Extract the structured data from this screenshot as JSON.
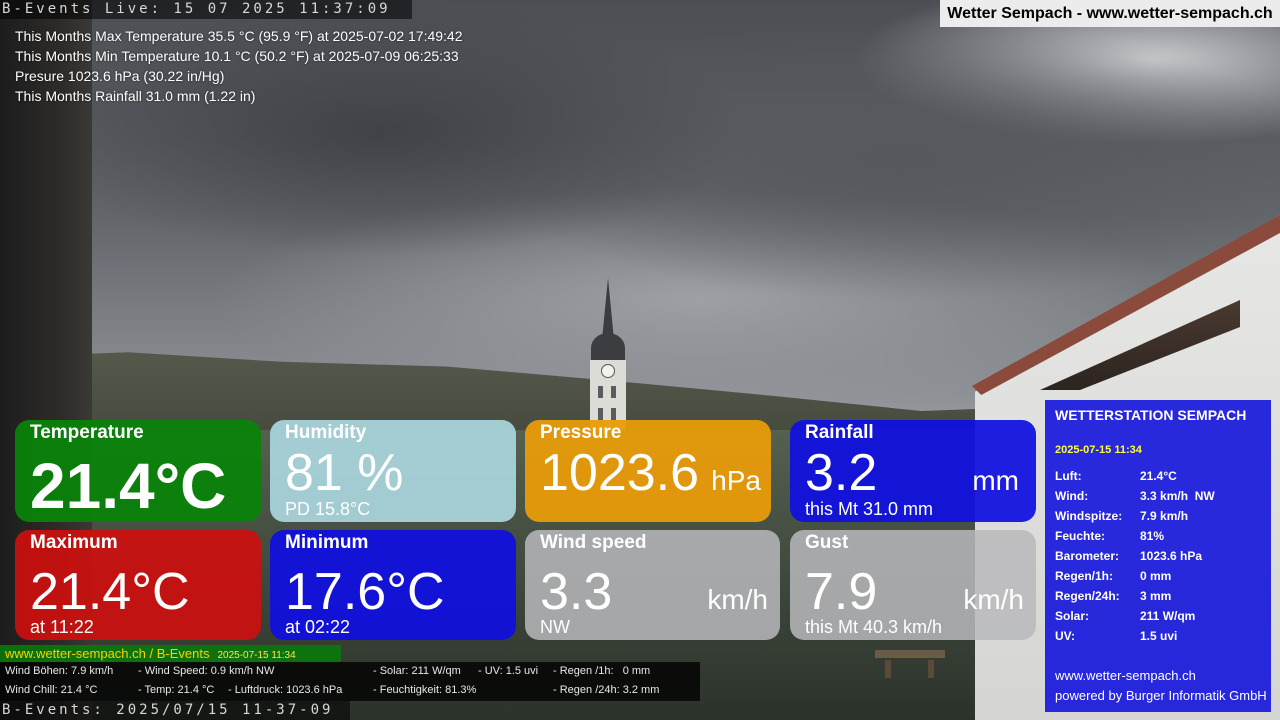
{
  "live_top": "B-Events Live: 15 07 2025 11:37:09",
  "live_bottom": "B-Events: 2025/07/15 11-37-09",
  "site_title": "Wetter Sempach - www.wetter-sempach.ch",
  "stats": [
    "This Months Max Temperature 35.5 °C (95.9 °F) at 2025-07-02 17:49:42",
    "This Months Min Temperature 10.1 °C (50.2 °F) at 2025-07-09 06:25:33",
    "Presure 1023.6 hPa (30.22 in/Hg)",
    "This Months Rainfall 31.0 mm (1.22 in)"
  ],
  "tiles": {
    "temperature": {
      "title": "Temperature",
      "value": "21.4°C",
      "color": "#0a820a"
    },
    "humidity": {
      "title": "Humidity",
      "value": "81 %",
      "sub": "PD 15.8°C",
      "color": "#aad6de"
    },
    "pressure": {
      "title": "Pressure",
      "value": "1023.6",
      "unit": "hPa",
      "color": "#e89b0a"
    },
    "rainfall": {
      "title": "Rainfall",
      "value": "3.2",
      "unit": "mm",
      "sub": "this Mt 31.0 mm",
      "color": "#0f0fe1"
    },
    "maximum": {
      "title": "Maximum",
      "value": "21.4°C",
      "sub": "at 11:22",
      "color": "#cd0f0f"
    },
    "minimum": {
      "title": "Minimum",
      "value": "17.6°C",
      "sub": "at 02:22",
      "color": "#0f0fe1"
    },
    "wind_speed": {
      "title": "Wind speed",
      "value": "3.3",
      "unit": "km/h",
      "sub": "NW",
      "color": "#b9b9bc"
    },
    "gust": {
      "title": "Gust",
      "value": "7.9",
      "unit": "km/h",
      "sub": "this Mt 40.3 km/h",
      "color": "#b9b9bc"
    }
  },
  "panel": {
    "title": "WETTERSTATION SEMPACH",
    "date": "2025-07-15 11:34",
    "rows": [
      {
        "k": "Luft:",
        "v": "21.4°C"
      },
      {
        "k": "Wind:",
        "v": "3.3 km/h  NW"
      },
      {
        "k": "Windspitze:",
        "v": "7.9 km/h"
      },
      {
        "k": "Feuchte:",
        "v": "81%"
      },
      {
        "k": "Barometer:",
        "v": "1023.6 hPa"
      },
      {
        "k": "Regen/1h:",
        "v": "0 mm"
      },
      {
        "k": "Regen/24h:",
        "v": "3 mm"
      },
      {
        "k": "Solar:",
        "v": "211 W/qm"
      },
      {
        "k": "UV:",
        "v": "1.5 uvi"
      }
    ],
    "foot1": "www.wetter-sempach.ch",
    "foot2": "powered by Burger Informatik GmbH"
  },
  "green_bar": {
    "site": "www.wetter-sempach.ch / B-Events",
    "ts": "2025-07-15 11:34"
  },
  "dark_bar": {
    "r1c1": "Wind Böhen: 7.9 km/h",
    "r1c2": "- Wind Speed: 0.9 km/h NW",
    "r1c3": "- Solar: 211 W/qm",
    "r1c4": "- UV: 1.5 uvi",
    "r1c5": "- Regen /1h:   0 mm",
    "r2c1": "Wind Chill: 21.4 °C",
    "r2c2": "- Temp: 21.4 °C",
    "r2c3": "- Luftdruck: 1023.6 hPa",
    "r2c4": "- Feuchtigkeit: 81.3%",
    "r2c5": "- Regen /24h: 3.2 mm"
  }
}
